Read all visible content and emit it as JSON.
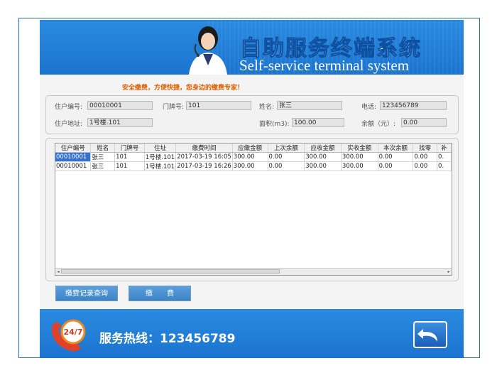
{
  "header": {
    "title_cn": "自助服务终端系统",
    "title_en": "Self-service terminal system",
    "slogan": "安全缴费，方便快捷，您身边的缴费专家！"
  },
  "info": {
    "resident_no": {
      "label": "住户编号:",
      "value": "00010001"
    },
    "door_no": {
      "label": "门牌号:",
      "value": "101"
    },
    "name": {
      "label": "姓名:",
      "value": "张三"
    },
    "phone": {
      "label": "电话:",
      "value": "123456789"
    },
    "address": {
      "label": "住户地址:",
      "value": "1号楼.101"
    },
    "area": {
      "label": "面积(m3):",
      "value": "100.00"
    },
    "balance": {
      "label": "余额（元）:",
      "value": "0.00"
    }
  },
  "table": {
    "columns": [
      "住户编号",
      "姓名",
      "门牌号",
      "住址",
      "缴费时间",
      "应缴金额",
      "上次余额",
      "应收金额",
      "实收金额",
      "本次余额",
      "找零",
      "补"
    ],
    "rows": [
      [
        "00010001",
        "张三",
        "101",
        "1号楼.101",
        "2017-03-19 16:05",
        "300.00",
        "0.00",
        "300.00",
        "300.00",
        "0.00",
        "0.00",
        "0."
      ],
      [
        "00010001",
        "张三",
        "101",
        "1号楼.101",
        "2017-03-19 16:26",
        "300.00",
        "0.00",
        "300.00",
        "300.00",
        "0.00",
        "0.00",
        "0."
      ]
    ]
  },
  "buttons": {
    "history": "缴费记录查询",
    "pay": "缴　　费"
  },
  "footer": {
    "hotline": "服务热线：123456789",
    "badge": "24/7"
  },
  "icons": {
    "phone": "phone-24-7-icon",
    "back": "back-arrow-icon"
  },
  "colors": {
    "brand_blue": "#1b74cf",
    "slogan_orange": "#e06000",
    "selected_row": "#3370d8"
  }
}
